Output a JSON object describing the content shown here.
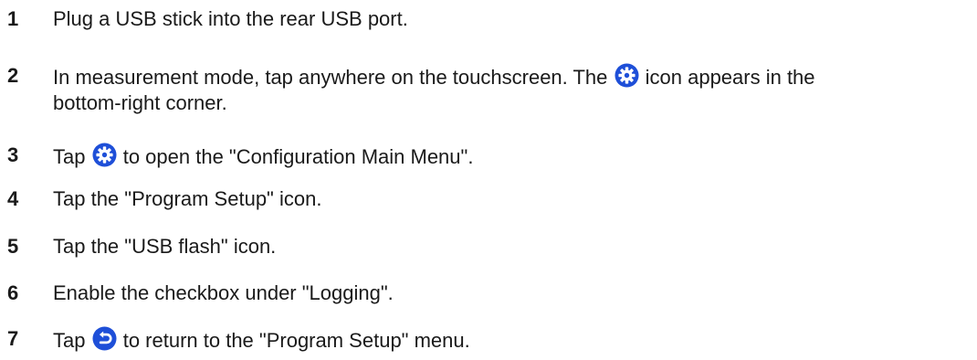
{
  "icons": {
    "settings": "gear-icon",
    "back": "return-arrow-icon",
    "icon_color": "#1e4fd8"
  },
  "steps": [
    {
      "number": "1",
      "text": "Plug a USB stick into the rear USB port."
    },
    {
      "number": "2",
      "text_before": "In measurement mode, tap anywhere on the touchscreen. The ",
      "text_after": " icon appears in the",
      "text_line2": "bottom-right corner."
    },
    {
      "number": "3",
      "text_before": "Tap ",
      "text_after": " to open the \"Configuration Main Menu\"."
    },
    {
      "number": "4",
      "text": "Tap the \"Program Setup\" icon."
    },
    {
      "number": "5",
      "text": "Tap the \"USB flash\" icon."
    },
    {
      "number": "6",
      "text": "Enable the checkbox under \"Logging\"."
    },
    {
      "number": "7",
      "text_before": "Tap ",
      "text_after": " to return to the \"Program Setup\" menu."
    }
  ]
}
